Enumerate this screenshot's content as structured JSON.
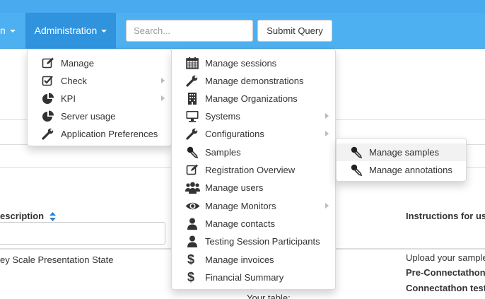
{
  "navbar": {
    "prev_item_label": "n",
    "admin_label": "Administration",
    "search_placeholder": "Search...",
    "submit_label": "Submit Query"
  },
  "admin_menu": [
    {
      "label": "Manage",
      "icon": "edit-icon",
      "submenu": false
    },
    {
      "label": "Check",
      "icon": "checkbox-icon",
      "submenu": true
    },
    {
      "label": "KPI",
      "icon": "pie-chart-icon",
      "submenu": true
    },
    {
      "label": "Server usage",
      "icon": "pie-chart-icon",
      "submenu": false
    },
    {
      "label": "Application Preferences",
      "icon": "wrench-icon",
      "submenu": false
    }
  ],
  "manage_menu": [
    {
      "label": "Manage sessions",
      "icon": "calendar-icon",
      "submenu": false
    },
    {
      "label": "Manage demonstrations",
      "icon": "wrench-icon",
      "submenu": false
    },
    {
      "label": "Manage Organizations",
      "icon": "building-icon",
      "submenu": false
    },
    {
      "label": "Systems",
      "icon": "monitor-icon",
      "submenu": true
    },
    {
      "label": "Configurations",
      "icon": "wrench-icon",
      "submenu": true
    },
    {
      "label": "Samples",
      "icon": "eyedropper-icon",
      "submenu": false
    },
    {
      "label": "Registration Overview",
      "icon": "edit-icon",
      "submenu": false
    },
    {
      "label": "Manage users",
      "icon": "users-icon",
      "submenu": false
    },
    {
      "label": "Manage Monitors",
      "icon": "eye-icon",
      "submenu": true
    },
    {
      "label": "Manage contacts",
      "icon": "user-icon",
      "submenu": false
    },
    {
      "label": "Testing Session Participants",
      "icon": "user-icon",
      "submenu": false
    },
    {
      "label": "Manage invoices",
      "icon": "dollar-icon",
      "submenu": false
    },
    {
      "label": "Financial Summary",
      "icon": "dollar-icon",
      "submenu": false
    }
  ],
  "samples_menu": [
    {
      "label": "Manage samples",
      "icon": "eyedropper-icon",
      "active": true
    },
    {
      "label": "Manage annotations",
      "icon": "eyedropper-icon",
      "active": false
    }
  ],
  "table": {
    "header_description": "escription",
    "header_instructions": "Instructions for us",
    "row_description": "ey Scale Presentation State",
    "row_instructions_1": "Upload your sample",
    "row_instructions_2": "Pre-Connectathon",
    "row_instructions_3": "Connectathon test",
    "row_partial_text": "Your table:"
  },
  "colors": {
    "navbar": "#4db0f0",
    "navbar_active": "#2f93de",
    "sort_icon": "#2f80c8"
  }
}
